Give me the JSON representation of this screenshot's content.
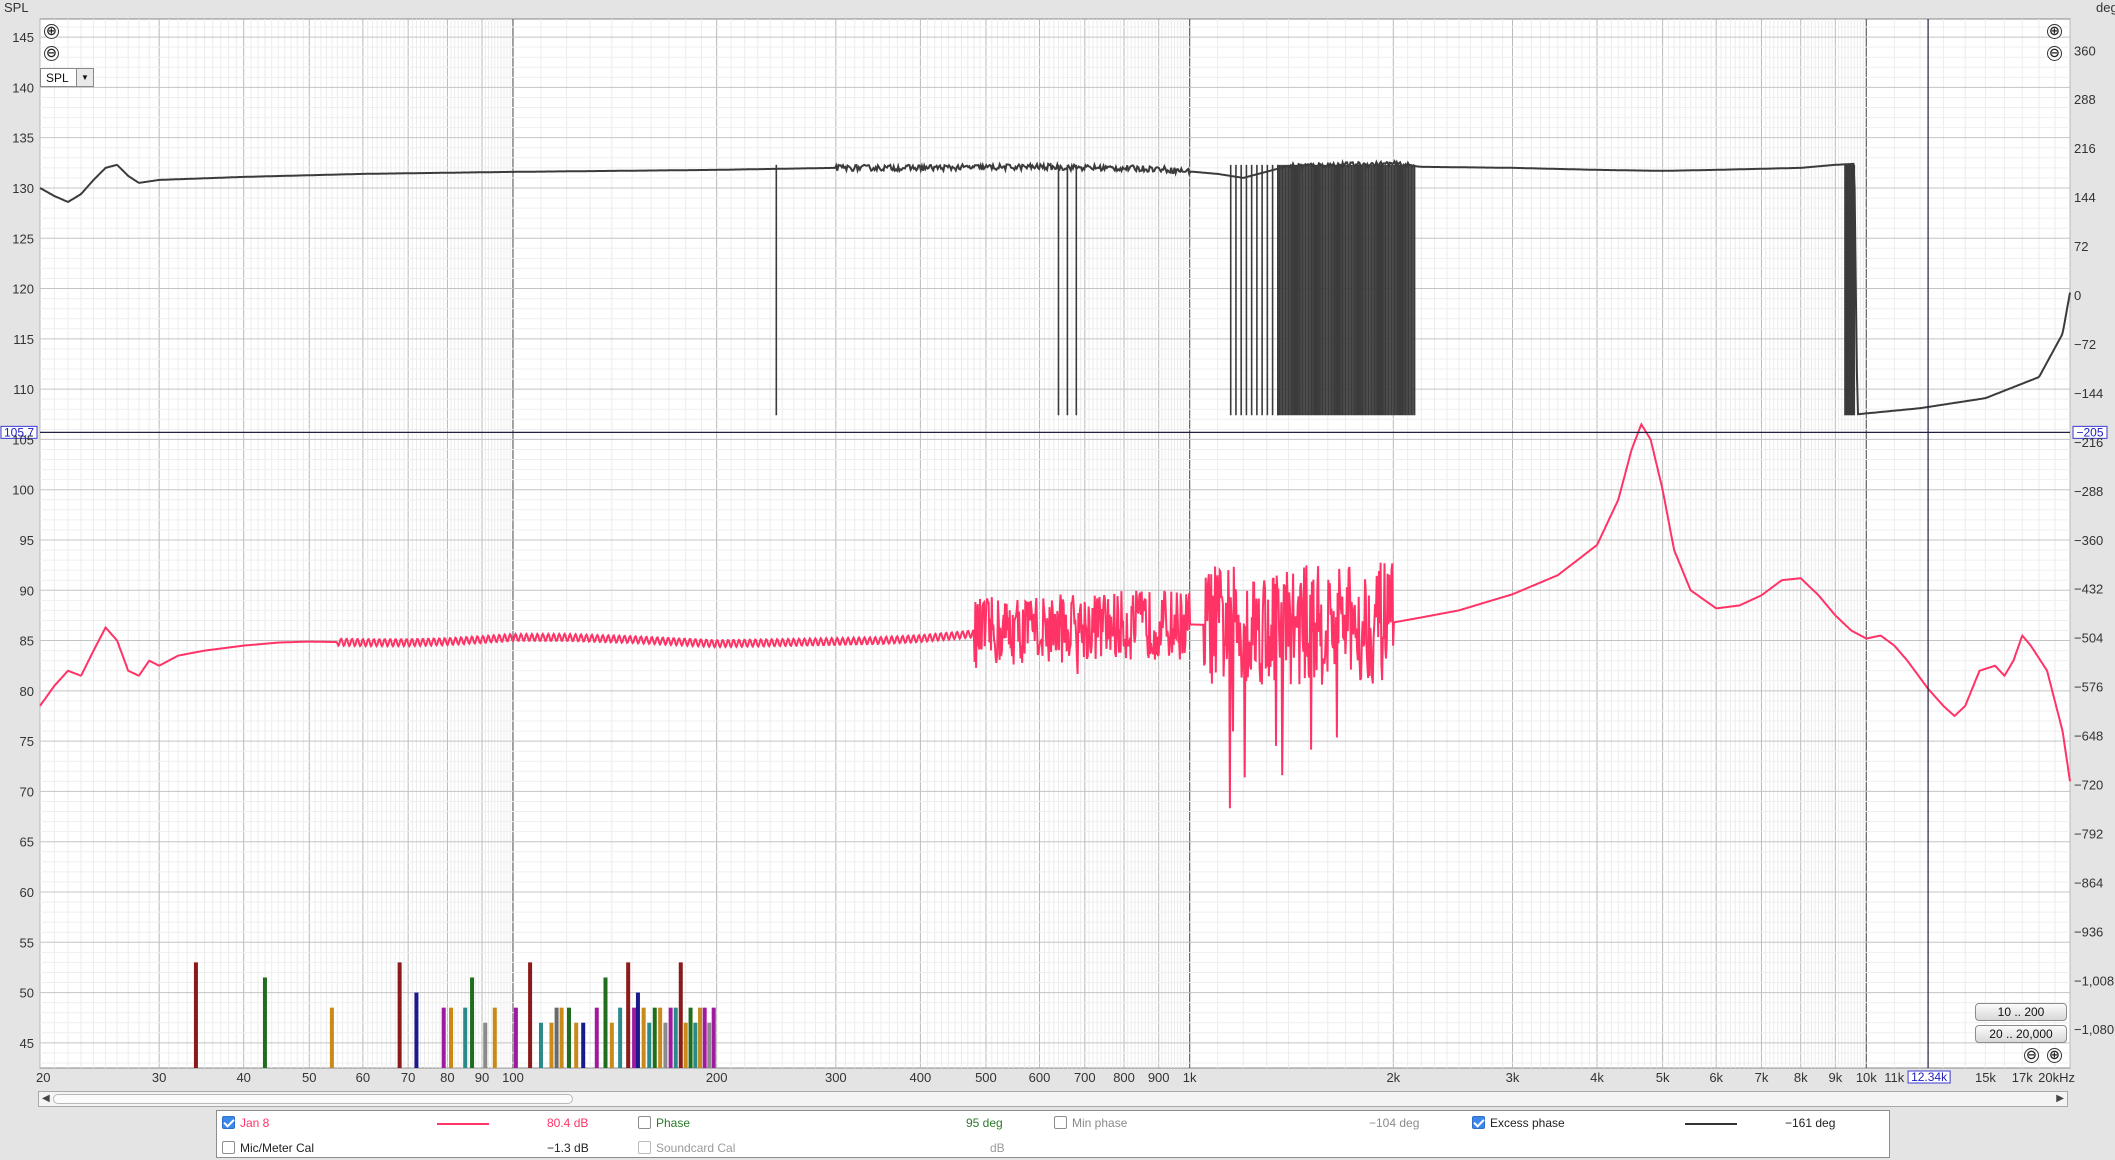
{
  "chart_data": {
    "type": "line",
    "x_scale": "log",
    "x_range": [
      20,
      20000
    ],
    "x_ticks": [
      {
        "v": 20,
        "l": "20"
      },
      {
        "v": 30,
        "l": "30"
      },
      {
        "v": 40,
        "l": "40"
      },
      {
        "v": 50,
        "l": "50"
      },
      {
        "v": 60,
        "l": "60"
      },
      {
        "v": 70,
        "l": "70"
      },
      {
        "v": 80,
        "l": "80"
      },
      {
        "v": 90,
        "l": "90"
      },
      {
        "v": 100,
        "l": "100"
      },
      {
        "v": 200,
        "l": "200"
      },
      {
        "v": 300,
        "l": "300"
      },
      {
        "v": 400,
        "l": "400"
      },
      {
        "v": 500,
        "l": "500"
      },
      {
        "v": 600,
        "l": "600"
      },
      {
        "v": 700,
        "l": "700"
      },
      {
        "v": 800,
        "l": "800"
      },
      {
        "v": 900,
        "l": "900"
      },
      {
        "v": 1000,
        "l": "1k"
      },
      {
        "v": 2000,
        "l": "2k"
      },
      {
        "v": 3000,
        "l": "3k"
      },
      {
        "v": 4000,
        "l": "4k"
      },
      {
        "v": 5000,
        "l": "5k"
      },
      {
        "v": 6000,
        "l": "6k"
      },
      {
        "v": 7000,
        "l": "7k"
      },
      {
        "v": 8000,
        "l": "8k"
      },
      {
        "v": 9000,
        "l": "9k"
      },
      {
        "v": 10000,
        "l": "10k"
      },
      {
        "v": 11000,
        "l": "11k"
      },
      {
        "v": 15000,
        "l": "15k"
      },
      {
        "v": 17000,
        "l": "17k"
      },
      {
        "v": 20000,
        "l": "20kHz"
      }
    ],
    "y_left": {
      "title": "SPL",
      "range": [
        42.5,
        146.8
      ],
      "ticks": [
        45,
        50,
        55,
        60,
        65,
        70,
        75,
        80,
        85,
        90,
        95,
        100,
        105,
        110,
        115,
        120,
        125,
        130,
        135,
        140,
        145
      ]
    },
    "y_right": {
      "title": "deg",
      "range": [
        -1137,
        406
      ],
      "ticks": [
        {
          "v": 360,
          "l": "360"
        },
        {
          "v": 288,
          "l": "288"
        },
        {
          "v": 216,
          "l": "216"
        },
        {
          "v": 144,
          "l": "144"
        },
        {
          "v": 72,
          "l": "72"
        },
        {
          "v": 0,
          "l": "0"
        },
        {
          "v": -72,
          "l": "−72"
        },
        {
          "v": -144,
          "l": "−144"
        },
        {
          "v": -216,
          "l": "−216"
        },
        {
          "v": -288,
          "l": "−288"
        },
        {
          "v": -360,
          "l": "−360"
        },
        {
          "v": -432,
          "l": "−432"
        },
        {
          "v": -504,
          "l": "−504"
        },
        {
          "v": -576,
          "l": "−576"
        },
        {
          "v": -648,
          "l": "−648"
        },
        {
          "v": -720,
          "l": "−720"
        },
        {
          "v": -792,
          "l": "−792"
        },
        {
          "v": -864,
          "l": "−864"
        },
        {
          "v": -936,
          "l": "−936"
        },
        {
          "v": -1008,
          "l": "−1,008"
        },
        {
          "v": -1080,
          "l": "−1,080"
        }
      ]
    },
    "cursor": {
      "spl": "105.7",
      "deg": "−205",
      "freq": "12.34k"
    },
    "series": [
      {
        "name": "Jan 8",
        "axis": "spl",
        "color": "#ff3366",
        "points": [
          [
            20,
            78.5
          ],
          [
            21,
            80.5
          ],
          [
            22,
            82
          ],
          [
            23,
            81.5
          ],
          [
            24,
            84
          ],
          [
            25,
            86.3
          ],
          [
            26,
            85
          ],
          [
            27,
            82
          ],
          [
            28,
            81.5
          ],
          [
            29,
            83
          ],
          [
            30,
            82.5
          ],
          [
            32,
            83.5
          ],
          [
            35,
            84
          ],
          [
            40,
            84.5
          ],
          [
            45,
            84.8
          ],
          [
            50,
            84.9
          ],
          [
            60,
            84.8
          ],
          [
            70,
            84.8
          ],
          [
            80,
            84.9
          ],
          [
            90,
            85.1
          ],
          [
            100,
            85.3
          ],
          [
            120,
            85.3
          ],
          [
            150,
            85.1
          ],
          [
            200,
            84.7
          ],
          [
            250,
            84.8
          ],
          [
            300,
            84.9
          ],
          [
            350,
            85
          ],
          [
            400,
            85.2
          ],
          [
            450,
            85.5
          ],
          [
            500,
            85.8
          ],
          [
            550,
            86
          ],
          [
            600,
            86.2
          ],
          [
            700,
            86.4
          ],
          [
            800,
            86.5
          ],
          [
            900,
            86.6
          ],
          [
            1000,
            86.6
          ],
          [
            1200,
            86.5
          ],
          [
            1400,
            86.5
          ],
          [
            1600,
            86.6
          ],
          [
            1800,
            86.7
          ],
          [
            2000,
            86.8
          ],
          [
            2200,
            87.3
          ],
          [
            2500,
            88
          ],
          [
            2800,
            89
          ],
          [
            3000,
            89.6
          ],
          [
            3500,
            91.5
          ],
          [
            4000,
            94.5
          ],
          [
            4300,
            99
          ],
          [
            4500,
            104
          ],
          [
            4650,
            106.5
          ],
          [
            4800,
            105
          ],
          [
            5000,
            100
          ],
          [
            5200,
            94
          ],
          [
            5500,
            90
          ],
          [
            6000,
            88.2
          ],
          [
            6500,
            88.5
          ],
          [
            7000,
            89.5
          ],
          [
            7500,
            91
          ],
          [
            8000,
            91.2
          ],
          [
            8500,
            89.5
          ],
          [
            9000,
            87.5
          ],
          [
            9500,
            86
          ],
          [
            10000,
            85.2
          ],
          [
            10500,
            85.5
          ],
          [
            11000,
            84.5
          ],
          [
            11500,
            83
          ],
          [
            12340,
            80.2
          ],
          [
            13000,
            78.5
          ],
          [
            13500,
            77.5
          ],
          [
            14000,
            78.5
          ],
          [
            14700,
            82
          ],
          [
            15500,
            82.5
          ],
          [
            16000,
            81.5
          ],
          [
            16500,
            83
          ],
          [
            17000,
            85.5
          ],
          [
            17500,
            84.5
          ],
          [
            18500,
            82
          ],
          [
            19500,
            76
          ],
          [
            20000,
            71
          ]
        ],
        "noise_bands": [
          {
            "from": 480,
            "to": 1000,
            "amp": 3.5,
            "spikes": 9,
            "depth": 7
          },
          {
            "from": 1050,
            "to": 2000,
            "amp": 6,
            "spikes": 16,
            "depth": 28
          }
        ]
      },
      {
        "name": "Excess phase",
        "axis": "deg",
        "color": "#3b3b3b",
        "points": [
          [
            20,
            130
          ],
          [
            21,
            129.2
          ],
          [
            22,
            128.6
          ],
          [
            23,
            129.4
          ],
          [
            24,
            130.8
          ],
          [
            25,
            132
          ],
          [
            26,
            132.3
          ],
          [
            27,
            131.2
          ],
          [
            28,
            130.5
          ],
          [
            30,
            130.8
          ],
          [
            40,
            131.1
          ],
          [
            60,
            131.4
          ],
          [
            100,
            131.6
          ],
          [
            200,
            131.8
          ],
          [
            300,
            132
          ],
          [
            400,
            132
          ],
          [
            600,
            132.1
          ],
          [
            900,
            131.9
          ],
          [
            1100,
            131.4
          ],
          [
            1200,
            131
          ],
          [
            1400,
            132.2
          ],
          [
            2000,
            132.4
          ],
          [
            2200,
            132.1
          ],
          [
            3000,
            132
          ],
          [
            4000,
            131.8
          ],
          [
            5000,
            131.7
          ],
          [
            6000,
            131.8
          ],
          [
            8000,
            132
          ],
          [
            9000,
            132.3
          ],
          [
            9600,
            132.4
          ],
          [
            9700,
            107.5
          ],
          [
            12000,
            108.1
          ],
          [
            15000,
            109.1
          ],
          [
            18000,
            111.2
          ],
          [
            19500,
            115.5
          ],
          [
            20000,
            119.6
          ]
        ],
        "wrap_bands": [
          {
            "from": 245,
            "to": 246.5,
            "count": 1
          },
          {
            "from": 640,
            "to": 680,
            "count": 3
          },
          {
            "from": 1150,
            "to": 1350,
            "count": 10
          },
          {
            "from": 1350,
            "to": 2150,
            "count": 90
          },
          {
            "from": 9300,
            "to": 9600,
            "count": 9
          }
        ]
      }
    ],
    "distortion_bars": [
      {
        "f": 34,
        "db": 53,
        "c": "#8b1a1a"
      },
      {
        "f": 43,
        "db": 51.5,
        "c": "#1e6e1e"
      },
      {
        "f": 54,
        "db": 48.5,
        "c": "#c98a1a"
      },
      {
        "f": 68,
        "db": 53,
        "c": "#8b1a1a"
      },
      {
        "f": 72,
        "db": 50,
        "c": "#1a1a8b"
      },
      {
        "f": 79,
        "db": 48.5,
        "c": "#a01aa0"
      },
      {
        "f": 81,
        "db": 48.5,
        "c": "#c98a1a"
      },
      {
        "f": 85,
        "db": 48.5,
        "c": "#2a8a8a"
      },
      {
        "f": 87,
        "db": 51.5,
        "c": "#1e6e1e"
      },
      {
        "f": 91,
        "db": 47,
        "c": "#8a8a8a"
      },
      {
        "f": 94,
        "db": 48.5,
        "c": "#c98a1a"
      },
      {
        "f": 101,
        "db": 48.5,
        "c": "#a01aa0"
      },
      {
        "f": 106,
        "db": 53,
        "c": "#8b1a1a"
      },
      {
        "f": 110,
        "db": 47,
        "c": "#2a8a8a"
      },
      {
        "f": 114,
        "db": 47,
        "c": "#c98a1a"
      },
      {
        "f": 116,
        "db": 48.5,
        "c": "#6a6a6a"
      },
      {
        "f": 118,
        "db": 48.5,
        "c": "#c98a1a"
      },
      {
        "f": 121,
        "db": 48.5,
        "c": "#1e6e1e"
      },
      {
        "f": 124,
        "db": 47,
        "c": "#c98a1a"
      },
      {
        "f": 127,
        "db": 47,
        "c": "#1a1a8b"
      },
      {
        "f": 133,
        "db": 48.5,
        "c": "#a01aa0"
      },
      {
        "f": 137,
        "db": 51.5,
        "c": "#1e6e1e"
      },
      {
        "f": 140,
        "db": 47,
        "c": "#c98a1a"
      },
      {
        "f": 144,
        "db": 48.5,
        "c": "#2a8a8a"
      },
      {
        "f": 148,
        "db": 53,
        "c": "#8b1a1a"
      },
      {
        "f": 151,
        "db": 48.5,
        "c": "#a01aa0"
      },
      {
        "f": 153,
        "db": 50,
        "c": "#1a1a8b"
      },
      {
        "f": 156,
        "db": 48.5,
        "c": "#c98a1a"
      },
      {
        "f": 159,
        "db": 47,
        "c": "#2a8a8a"
      },
      {
        "f": 162,
        "db": 48.5,
        "c": "#1e6e1e"
      },
      {
        "f": 165,
        "db": 48.5,
        "c": "#c98a1a"
      },
      {
        "f": 168,
        "db": 47,
        "c": "#8a8a8a"
      },
      {
        "f": 171,
        "db": 48.5,
        "c": "#a01aa0"
      },
      {
        "f": 174,
        "db": 48.5,
        "c": "#2a8a8a"
      },
      {
        "f": 177,
        "db": 53,
        "c": "#8b1a1a"
      },
      {
        "f": 180,
        "db": 47,
        "c": "#c98a1a"
      },
      {
        "f": 183,
        "db": 48.5,
        "c": "#1e6e1e"
      },
      {
        "f": 186,
        "db": 47,
        "c": "#2a8a8a"
      },
      {
        "f": 189,
        "db": 48.5,
        "c": "#c98a1a"
      },
      {
        "f": 192,
        "db": 48.5,
        "c": "#a01aa0"
      },
      {
        "f": 195,
        "db": 47,
        "c": "#8a8a8a"
      },
      {
        "f": 198,
        "db": 48.5,
        "c": "#a01aa0"
      }
    ]
  },
  "controls": {
    "zoom_in": "⊕",
    "zoom_out": "⊖",
    "plot_selector": "SPL",
    "range_full_audio": "20 .. 20,000",
    "range_low": "10 .. 200"
  },
  "legend": {
    "jan8": {
      "label": "Jan 8",
      "value": "80.4 dB",
      "checked": true,
      "color": "#ff3366"
    },
    "phase": {
      "label": "Phase",
      "value": "95 deg",
      "checked": false,
      "color": "#2a7a2a"
    },
    "min_phase": {
      "label": "Min phase",
      "value": "−104 deg",
      "checked": false
    },
    "excess_phase": {
      "label": "Excess phase",
      "value": "−161 deg",
      "checked": true,
      "color": "#333333"
    },
    "mic_cal": {
      "label": "Mic/Meter Cal",
      "value": "−1.3 dB",
      "checked": false
    },
    "soundcard_cal": {
      "label": "Soundcard Cal",
      "value": "dB",
      "checked": false
    }
  }
}
